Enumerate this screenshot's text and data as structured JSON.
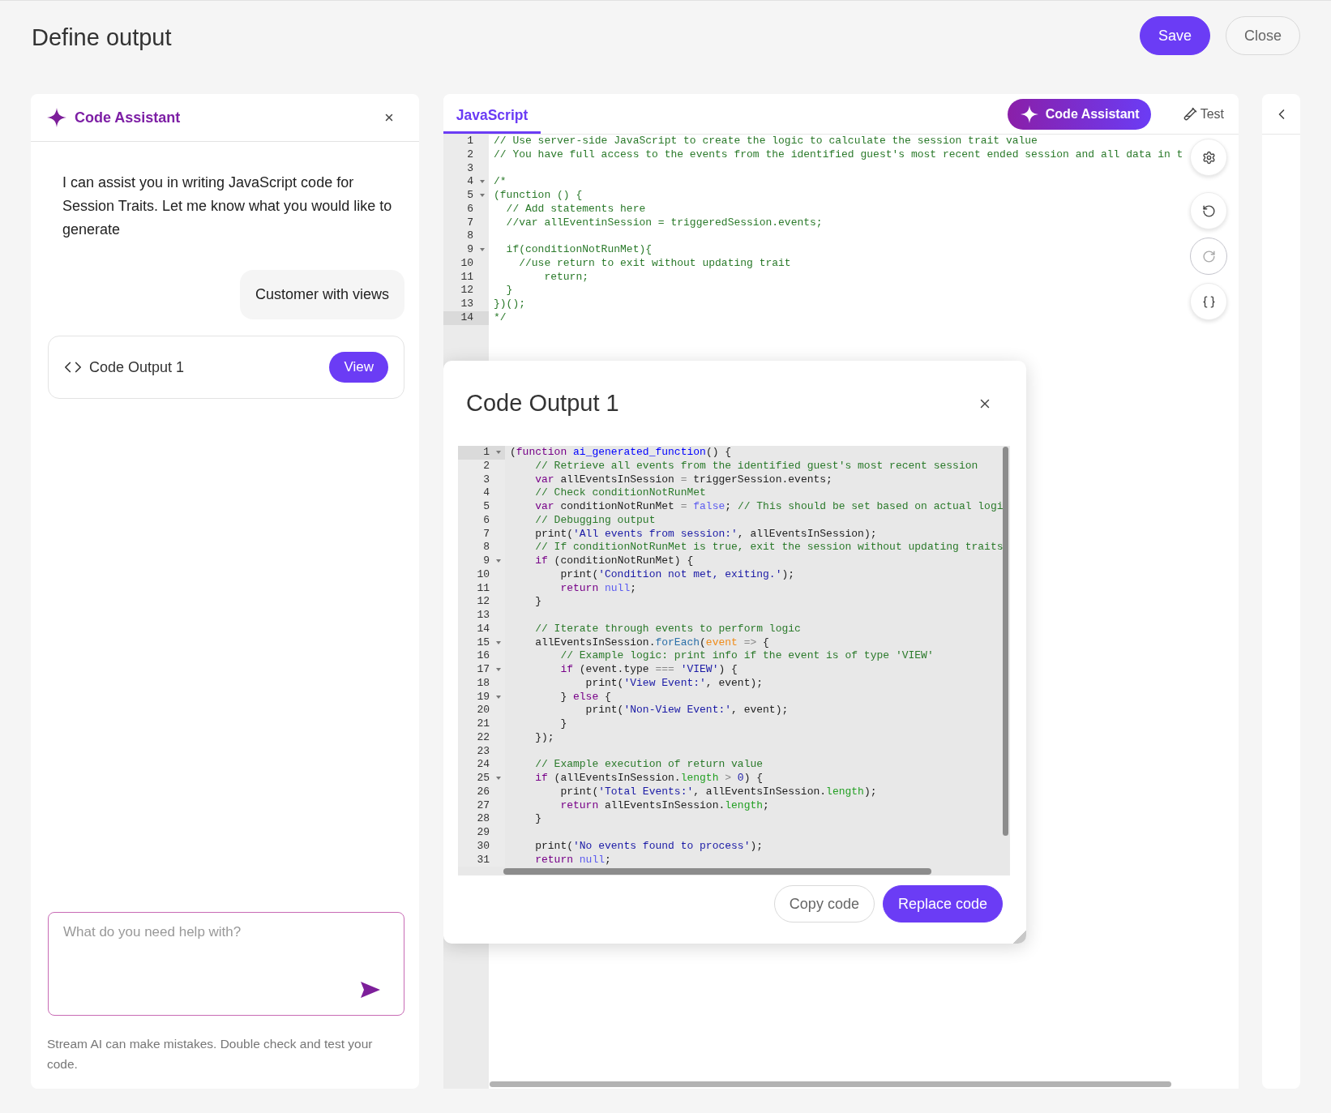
{
  "page": {
    "title": "Define output",
    "actions": [
      {
        "label": "Save",
        "kind": "primary"
      },
      {
        "label": "Close",
        "kind": "secondary"
      }
    ]
  },
  "assistant": {
    "title": "Code Assistant",
    "intro": "I can assist you in writing JavaScript code for Session Traits. Let me know what you would like to generate",
    "user_message": "Customer with views",
    "output_card": {
      "label": "Code Output 1",
      "button": "View"
    },
    "input": {
      "placeholder": "What do you need help with?"
    },
    "disclaimer": "Stream AI can make mistakes. Double check and test your code."
  },
  "editor": {
    "tabs": [
      {
        "label": "JavaScript",
        "selected": true
      }
    ],
    "assistant_button": "Code Assistant",
    "test_button": "Test",
    "tools": [
      {
        "kind": "settings",
        "disabled": false
      },
      {
        "kind": "undo",
        "disabled": false
      },
      {
        "kind": "redo",
        "disabled": true
      },
      {
        "kind": "format",
        "disabled": false
      }
    ],
    "lines": [
      {
        "n": "1",
        "fold": false,
        "active": false,
        "tokens": [
          {
            "kind": "comment",
            "t": "// Use server-side JavaScript to create the logic to calculate the session trait value"
          }
        ]
      },
      {
        "n": "2",
        "fold": false,
        "active": false,
        "tokens": [
          {
            "kind": "comment",
            "t": "// You have full access to the events from the identified guest's most recent ended session and all data in t"
          }
        ]
      },
      {
        "n": "3",
        "fold": false,
        "active": false
      },
      {
        "n": "4",
        "fold": true,
        "active": false,
        "tokens": [
          {
            "kind": "comment",
            "t": "/*"
          }
        ]
      },
      {
        "n": "5",
        "fold": true,
        "active": false,
        "tokens": [
          {
            "kind": "comment",
            "t": "(function () {"
          }
        ]
      },
      {
        "n": "6",
        "fold": false,
        "active": false,
        "tokens": [
          {
            "kind": "comment",
            "t": "  // Add statements here"
          }
        ]
      },
      {
        "n": "7",
        "fold": false,
        "active": false,
        "tokens": [
          {
            "kind": "comment",
            "t": "  //var allEventinSession = triggeredSession.events;"
          }
        ]
      },
      {
        "n": "8",
        "fold": false,
        "active": false
      },
      {
        "n": "9",
        "fold": true,
        "active": false,
        "tokens": [
          {
            "kind": "comment",
            "t": "  if(conditionNotRunMet){"
          }
        ]
      },
      {
        "n": "10",
        "fold": false,
        "active": false,
        "tokens": [
          {
            "kind": "comment",
            "t": "    //use return to exit without updating trait"
          }
        ]
      },
      {
        "n": "11",
        "fold": false,
        "active": false,
        "tokens": [
          {
            "kind": "comment",
            "t": "        return;"
          }
        ]
      },
      {
        "n": "12",
        "fold": false,
        "active": false,
        "tokens": [
          {
            "kind": "comment",
            "t": "  }"
          }
        ]
      },
      {
        "n": "13",
        "fold": false,
        "active": false,
        "tokens": [
          {
            "kind": "comment",
            "t": "})();"
          }
        ]
      },
      {
        "n": "14",
        "fold": false,
        "active": true,
        "tokens": [
          {
            "kind": "comment",
            "t": "*/"
          }
        ]
      }
    ]
  },
  "modal": {
    "title": "Code Output 1",
    "buttons": [
      {
        "label": "Copy code",
        "kind": "secondary"
      },
      {
        "label": "Replace code",
        "kind": "primary"
      }
    ],
    "lines": [
      {
        "n": "1",
        "fold": true,
        "active": true,
        "tokens": [
          {
            "kind": "plain",
            "t": "("
          },
          {
            "kind": "keyword",
            "t": "function"
          },
          {
            "kind": "def",
            "t": " ai_generated_function"
          },
          {
            "kind": "plain",
            "t": "() {"
          }
        ]
      },
      {
        "n": "2",
        "fold": false,
        "active": false,
        "tokens": [
          {
            "kind": "comment",
            "t": "    // Retrieve all events from the identified guest's most recent session"
          }
        ]
      },
      {
        "n": "3",
        "fold": false,
        "active": false,
        "tokens": [
          {
            "kind": "keyword",
            "t": "    var"
          },
          {
            "kind": "plain",
            "t": " allEventsInSession "
          },
          {
            "kind": "operator",
            "t": "="
          },
          {
            "kind": "plain",
            "t": " triggerSession.events;"
          }
        ]
      },
      {
        "n": "4",
        "fold": false,
        "active": false,
        "tokens": [
          {
            "kind": "comment",
            "t": "    // Check conditionNotRunMet"
          }
        ]
      },
      {
        "n": "5",
        "fold": false,
        "active": false,
        "tokens": [
          {
            "kind": "keyword",
            "t": "    var"
          },
          {
            "kind": "plain",
            "t": " conditionNotRunMet "
          },
          {
            "kind": "operator",
            "t": "="
          },
          {
            "kind": "atom",
            "t": " false"
          },
          {
            "kind": "plain",
            "t": "; "
          },
          {
            "kind": "comment",
            "t": "// This should be set based on actual logi"
          }
        ]
      },
      {
        "n": "6",
        "fold": false,
        "active": false,
        "tokens": [
          {
            "kind": "comment",
            "t": "    // Debugging output"
          }
        ]
      },
      {
        "n": "7",
        "fold": false,
        "active": false,
        "tokens": [
          {
            "kind": "plain",
            "t": "    print("
          },
          {
            "kind": "string",
            "t": "'All events from session:'"
          },
          {
            "kind": "plain",
            "t": ", allEventsInSession);"
          }
        ]
      },
      {
        "n": "8",
        "fold": false,
        "active": false,
        "tokens": [
          {
            "kind": "comment",
            "t": "    // If conditionNotRunMet is true, exit the session without updating traits"
          }
        ]
      },
      {
        "n": "9",
        "fold": true,
        "active": false,
        "tokens": [
          {
            "kind": "keyword",
            "t": "    if"
          },
          {
            "kind": "plain",
            "t": " (conditionNotRunMet) {"
          }
        ]
      },
      {
        "n": "10",
        "fold": false,
        "active": false,
        "tokens": [
          {
            "kind": "plain",
            "t": "        print("
          },
          {
            "kind": "string",
            "t": "'Condition not met, exiting.'"
          },
          {
            "kind": "plain",
            "t": ");"
          }
        ]
      },
      {
        "n": "11",
        "fold": false,
        "active": false,
        "tokens": [
          {
            "kind": "keyword",
            "t": "        return"
          },
          {
            "kind": "atom",
            "t": " null"
          },
          {
            "kind": "plain",
            "t": ";"
          }
        ]
      },
      {
        "n": "12",
        "fold": false,
        "active": false,
        "tokens": [
          {
            "kind": "plain",
            "t": "    }"
          }
        ]
      },
      {
        "n": "13",
        "fold": false,
        "active": false
      },
      {
        "n": "14",
        "fold": false,
        "active": false,
        "tokens": [
          {
            "kind": "comment",
            "t": "    // Iterate through events to perform logic"
          }
        ]
      },
      {
        "n": "15",
        "fold": true,
        "active": false,
        "tokens": [
          {
            "kind": "plain",
            "t": "    allEventsInSession."
          },
          {
            "kind": "method",
            "t": "forEach"
          },
          {
            "kind": "plain",
            "t": "("
          },
          {
            "kind": "param",
            "t": "event"
          },
          {
            "kind": "operator",
            "t": " =>"
          },
          {
            "kind": "plain",
            "t": " {"
          }
        ]
      },
      {
        "n": "16",
        "fold": false,
        "active": false,
        "tokens": [
          {
            "kind": "comment",
            "t": "        // Example logic: print info if the event is of type 'VIEW'"
          }
        ]
      },
      {
        "n": "17",
        "fold": true,
        "active": false,
        "tokens": [
          {
            "kind": "keyword",
            "t": "        if"
          },
          {
            "kind": "plain",
            "t": " (event.type "
          },
          {
            "kind": "operator",
            "t": "==="
          },
          {
            "kind": "string",
            "t": " 'VIEW'"
          },
          {
            "kind": "plain",
            "t": ") {"
          }
        ]
      },
      {
        "n": "18",
        "fold": false,
        "active": false,
        "tokens": [
          {
            "kind": "plain",
            "t": "            print("
          },
          {
            "kind": "string",
            "t": "'View Event:'"
          },
          {
            "kind": "plain",
            "t": ", event);"
          }
        ]
      },
      {
        "n": "19",
        "fold": true,
        "active": false,
        "tokens": [
          {
            "kind": "plain",
            "t": "        } "
          },
          {
            "kind": "keyword",
            "t": "else"
          },
          {
            "kind": "plain",
            "t": " {"
          }
        ]
      },
      {
        "n": "20",
        "fold": false,
        "active": false,
        "tokens": [
          {
            "kind": "plain",
            "t": "            print("
          },
          {
            "kind": "string",
            "t": "'Non-View Event:'"
          },
          {
            "kind": "plain",
            "t": ", event);"
          }
        ]
      },
      {
        "n": "21",
        "fold": false,
        "active": false,
        "tokens": [
          {
            "kind": "plain",
            "t": "        }"
          }
        ]
      },
      {
        "n": "22",
        "fold": false,
        "active": false,
        "tokens": [
          {
            "kind": "plain",
            "t": "    });"
          }
        ]
      },
      {
        "n": "23",
        "fold": false,
        "active": false
      },
      {
        "n": "24",
        "fold": false,
        "active": false,
        "tokens": [
          {
            "kind": "comment",
            "t": "    // Example execution of return value"
          }
        ]
      },
      {
        "n": "25",
        "fold": true,
        "active": false,
        "tokens": [
          {
            "kind": "keyword",
            "t": "    if"
          },
          {
            "kind": "plain",
            "t": " (allEventsInSession."
          },
          {
            "kind": "property",
            "t": "length"
          },
          {
            "kind": "operator",
            "t": " >"
          },
          {
            "kind": "number",
            "t": " 0"
          },
          {
            "kind": "plain",
            "t": ") {"
          }
        ]
      },
      {
        "n": "26",
        "fold": false,
        "active": false,
        "tokens": [
          {
            "kind": "plain",
            "t": "        print("
          },
          {
            "kind": "string",
            "t": "'Total Events:'"
          },
          {
            "kind": "plain",
            "t": ", allEventsInSession."
          },
          {
            "kind": "property",
            "t": "length"
          },
          {
            "kind": "plain",
            "t": ");"
          }
        ]
      },
      {
        "n": "27",
        "fold": false,
        "active": false,
        "tokens": [
          {
            "kind": "keyword",
            "t": "        return"
          },
          {
            "kind": "plain",
            "t": " allEventsInSession."
          },
          {
            "kind": "property",
            "t": "length"
          },
          {
            "kind": "plain",
            "t": ";"
          }
        ]
      },
      {
        "n": "28",
        "fold": false,
        "active": false,
        "tokens": [
          {
            "kind": "plain",
            "t": "    }"
          }
        ]
      },
      {
        "n": "29",
        "fold": false,
        "active": false
      },
      {
        "n": "30",
        "fold": false,
        "active": false,
        "tokens": [
          {
            "kind": "plain",
            "t": "    print("
          },
          {
            "kind": "string",
            "t": "'No events found to process'"
          },
          {
            "kind": "plain",
            "t": ");"
          }
        ]
      },
      {
        "n": "31",
        "fold": false,
        "active": false,
        "tokens": [
          {
            "kind": "keyword",
            "t": "    return"
          },
          {
            "kind": "atom",
            "t": " null"
          },
          {
            "kind": "plain",
            "t": ";"
          }
        ]
      }
    ]
  }
}
